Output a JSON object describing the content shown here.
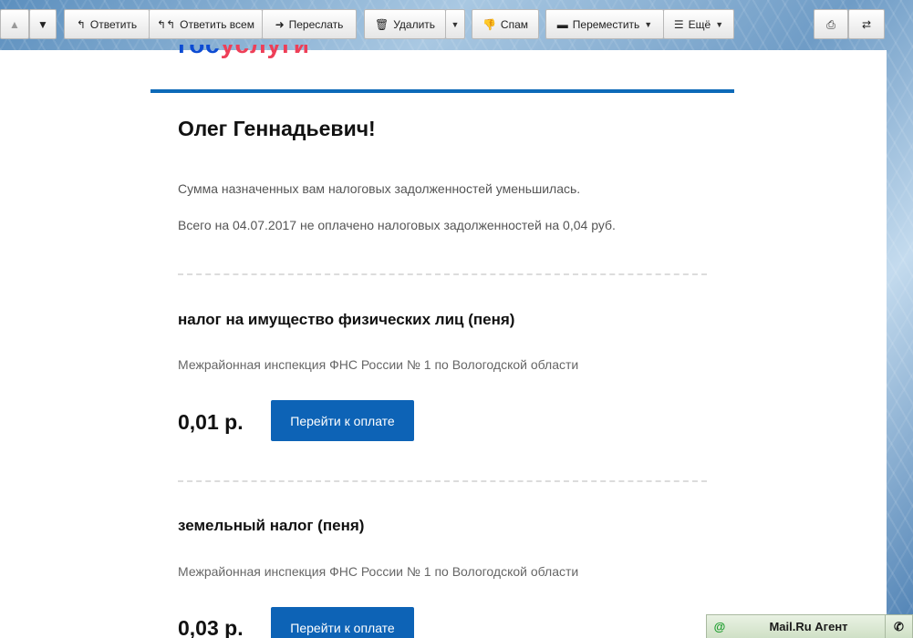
{
  "toolbar": {
    "reply": "Ответить",
    "reply_all": "Ответить всем",
    "forward": "Переслать",
    "delete": "Удалить",
    "spam": "Спам",
    "move": "Переместить",
    "more": "Ещё"
  },
  "letter": {
    "logo_part1": "гос",
    "logo_part2": "услуги",
    "greeting": "Олег Геннадьевич!",
    "line1": "Сумма назначенных вам налоговых задолженностей уменьшилась.",
    "line2": "Всего на 04.07.2017 не оплачено налоговых задолженностей на 0,04 руб.",
    "items": [
      {
        "title": "налог на имущество физических лиц (пеня)",
        "inspection": "Межрайонная инспекция ФНС России № 1 по Вологодской области",
        "amount": "0,01  р.",
        "pay": "Перейти к оплате"
      },
      {
        "title": "земельный налог (пеня)",
        "inspection": "Межрайонная инспекция ФНС России № 1 по Вологодской области",
        "amount": "0,03  р.",
        "pay": "Перейти к оплате"
      }
    ]
  },
  "agent": {
    "icon_text": "@",
    "title": "Mail.Ru Агент"
  },
  "colors": {
    "accent_blue": "#0d63b6",
    "rule_blue": "#0d6ab8",
    "logo_red": "#ee3f58"
  }
}
